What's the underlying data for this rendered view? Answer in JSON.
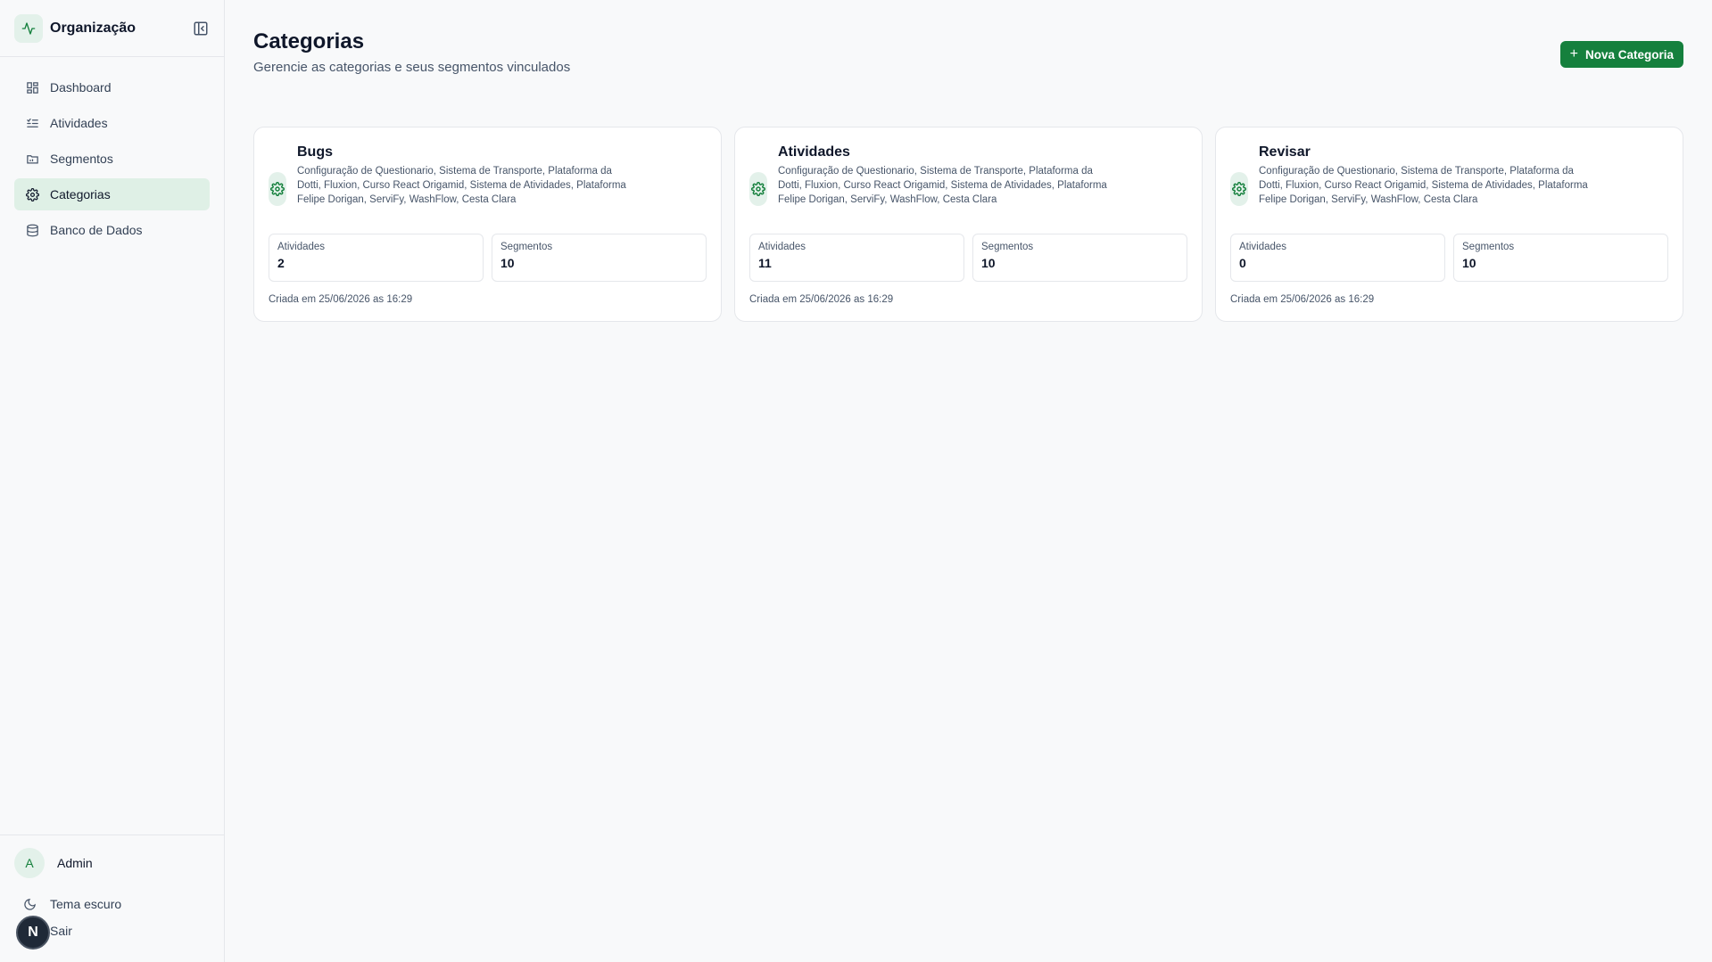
{
  "sidebar": {
    "org_name": "Organização",
    "nav": [
      {
        "label": "Dashboard",
        "icon": "dashboard-icon"
      },
      {
        "label": "Atividades",
        "icon": "list-icon"
      },
      {
        "label": "Segmentos",
        "icon": "folder-icon"
      },
      {
        "label": "Categorias",
        "icon": "gear-icon",
        "active": true
      },
      {
        "label": "Banco de Dados",
        "icon": "database-icon"
      }
    ],
    "user": {
      "initial": "A",
      "name": "Admin"
    },
    "theme_label": "Tema escuro",
    "logout_label": "Sair",
    "fab_label": "N"
  },
  "header": {
    "title": "Categorias",
    "subtitle": "Gerencie as categorias e seus segmentos vinculados",
    "new_button": "Nova Categoria"
  },
  "cards": [
    {
      "name": "Bugs",
      "segments": "Configuração de Questionario, Sistema de Transporte, Plataforma da Dotti, Fluxion, Curso React Origamid, Sistema de Atividades, Plataforma Felipe Dorigan, ServiFy, WashFlow, Cesta Clara",
      "stats": [
        {
          "label": "Atividades",
          "value": "2"
        },
        {
          "label": "Segmentos",
          "value": "10"
        }
      ],
      "created": "Criada em 25/06/2026 as 16:29"
    },
    {
      "name": "Atividades",
      "segments": "Configuração de Questionario, Sistema de Transporte, Plataforma da Dotti, Fluxion, Curso React Origamid, Sistema de Atividades, Plataforma Felipe Dorigan, ServiFy, WashFlow, Cesta Clara",
      "stats": [
        {
          "label": "Atividades",
          "value": "11"
        },
        {
          "label": "Segmentos",
          "value": "10"
        }
      ],
      "created": "Criada em 25/06/2026 as 16:29"
    },
    {
      "name": "Revisar",
      "segments": "Configuração de Questionario, Sistema de Transporte, Plataforma da Dotti, Fluxion, Curso React Origamid, Sistema de Atividades, Plataforma Felipe Dorigan, ServiFy, WashFlow, Cesta Clara",
      "stats": [
        {
          "label": "Atividades",
          "value": "0"
        },
        {
          "label": "Segmentos",
          "value": "10"
        }
      ],
      "created": "Criada em 25/06/2026 as 16:29"
    }
  ],
  "colors": {
    "accent": "#15803d",
    "accent_soft": "#dff0e6"
  }
}
